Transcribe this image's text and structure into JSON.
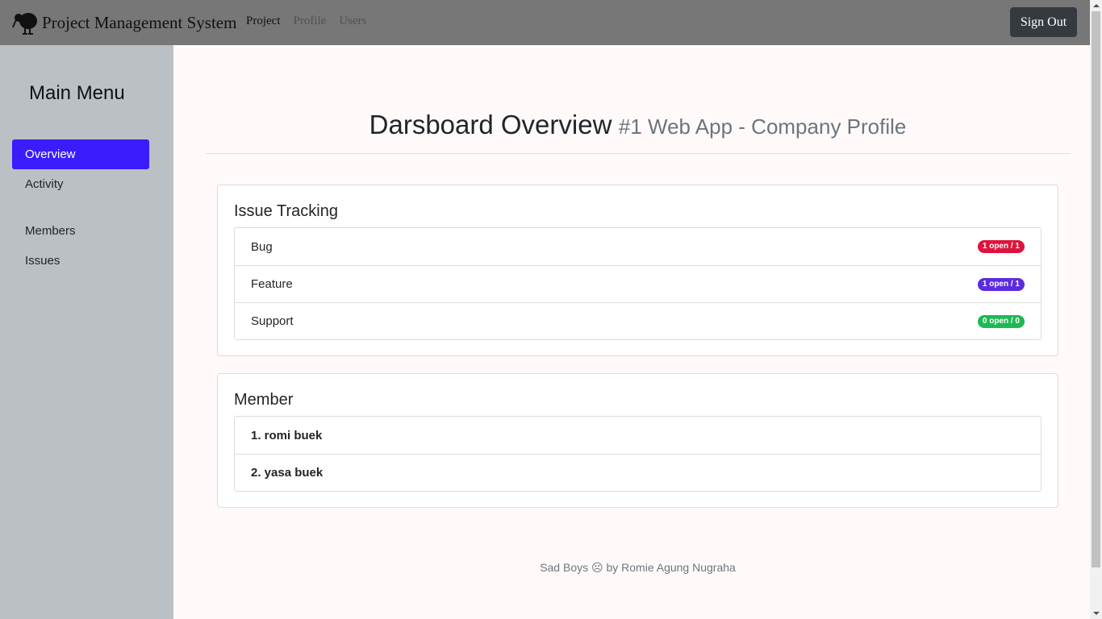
{
  "navbar": {
    "brand": "Project Management System",
    "links": [
      "Project",
      "Profile",
      "Users"
    ],
    "signout_label": "Sign Out"
  },
  "sidebar": {
    "title": "Main Menu",
    "items": [
      {
        "label": "Overview",
        "active": true
      },
      {
        "label": "Activity"
      },
      {
        "label": "Members"
      },
      {
        "label": "Issues"
      }
    ]
  },
  "header": {
    "title": "Darsboard Overview",
    "subtitle": "#1 Web App - Company Profile"
  },
  "issue_tracking": {
    "title": "Issue Tracking",
    "items": [
      {
        "label": "Bug",
        "badge": "1 open / 1",
        "color": "#dc143c"
      },
      {
        "label": "Feature",
        "badge": "1 open / 1",
        "color": "#5b2be0"
      },
      {
        "label": "Support",
        "badge": "0 open / 0",
        "color": "#1db954"
      }
    ]
  },
  "members": {
    "title": "Member",
    "items": [
      "1. romi buek",
      "2. yasa buek"
    ]
  },
  "footer": {
    "text": "Sad Boys ☹ by Romie Agung Nugraha"
  },
  "colors": {
    "navbar": "#777777",
    "sidebar": "#bbc0c4",
    "accent": "#3b1cff",
    "main_bg": "#fffaf9"
  }
}
